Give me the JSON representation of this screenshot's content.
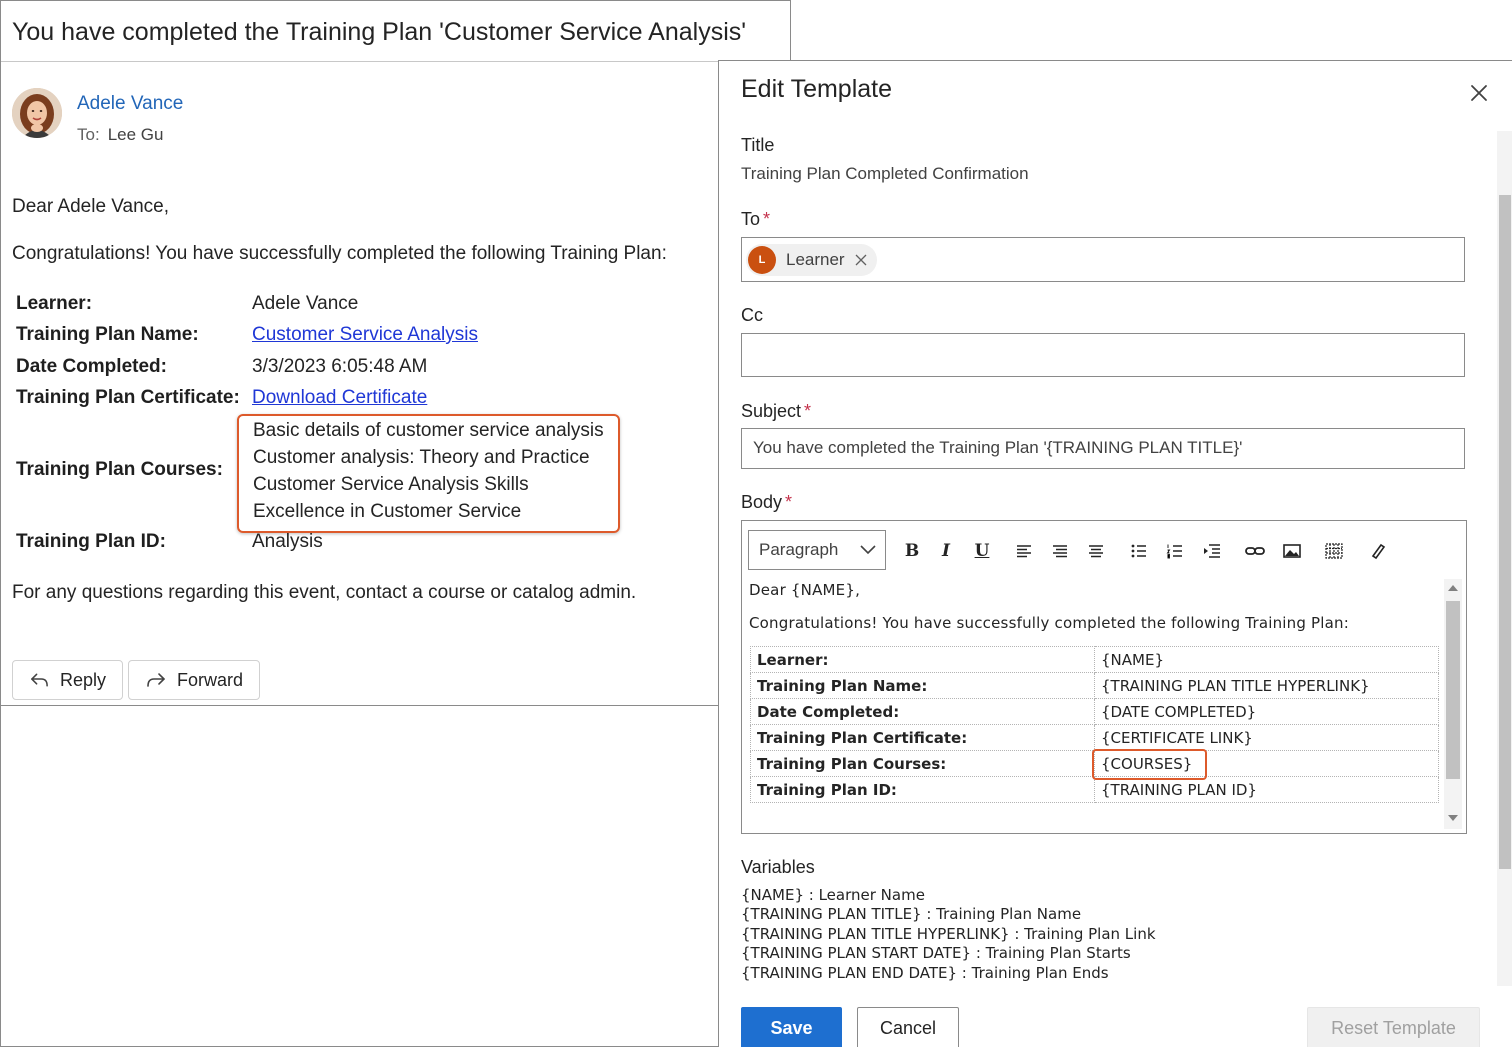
{
  "email": {
    "subject": "You have completed the Training Plan 'Customer Service Analysis'",
    "sender": "Adele Vance",
    "to_label": "To:",
    "to_value": "Lee Gu",
    "greeting": "Dear Adele Vance,",
    "intro": "Congratulations! You have successfully completed the following Training Plan:",
    "details": {
      "learner_label": "Learner:",
      "learner_value": "Adele Vance",
      "plan_name_label": "Training Plan Name:",
      "plan_name_value": "Customer Service Analysis",
      "date_label": "Date Completed:",
      "date_value": "3/3/2023 6:05:48 AM",
      "certificate_label": "Training Plan Certificate:",
      "certificate_value": "Download Certificate",
      "courses_label": "Training Plan Courses:",
      "courses": [
        "Basic details of customer service analysis",
        "Customer analysis: Theory and Practice",
        "Customer Service Analysis Skills",
        "Excellence in Customer Service"
      ],
      "id_label": "Training Plan ID:",
      "id_value": "Analysis"
    },
    "footer": "For any questions regarding this event, contact a course or catalog admin.",
    "reply_label": "Reply",
    "forward_label": "Forward"
  },
  "panel": {
    "title": "Edit Template",
    "title_label": "Title",
    "title_value": "Training Plan Completed Confirmation",
    "to_label": "To",
    "required_mark": "*",
    "to_chip_initial": "L",
    "to_chip_label": "Learner",
    "cc_label": "Cc",
    "subject_label": "Subject",
    "subject_value": "You have completed the Training Plan '{TRAINING PLAN TITLE}'",
    "body_label": "Body",
    "paragraph_select": "Paragraph",
    "editor": {
      "greeting": "Dear {NAME},",
      "intro": "Congratulations! You have successfully completed the following Training Plan:",
      "rows": [
        {
          "key": "Learner:",
          "value": "{NAME}"
        },
        {
          "key": "Training Plan Name:",
          "value": "{TRAINING PLAN TITLE HYPERLINK}"
        },
        {
          "key": "Date Completed:",
          "value": "{DATE COMPLETED}"
        },
        {
          "key": "Training Plan Certificate:",
          "value": "{CERTIFICATE LINK}"
        },
        {
          "key": "Training Plan Courses:",
          "value": "{COURSES}"
        },
        {
          "key": "Training Plan ID:",
          "value": "{TRAINING PLAN ID}"
        }
      ]
    },
    "variables_title": "Variables",
    "variables": [
      "{NAME} : Learner Name",
      "{TRAINING PLAN TITLE} : Training Plan Name",
      "{TRAINING PLAN TITLE HYPERLINK} : Training Plan Link",
      "{TRAINING PLAN START DATE} : Training Plan Starts",
      "{TRAINING PLAN END DATE} : Training Plan Ends"
    ],
    "save_label": "Save",
    "cancel_label": "Cancel",
    "reset_label": "Reset Template"
  },
  "colors": {
    "accent": "#1e6fd0",
    "highlight": "#dd5a2b",
    "chip_avatar": "#ca5010",
    "link": "#1f37d6"
  }
}
